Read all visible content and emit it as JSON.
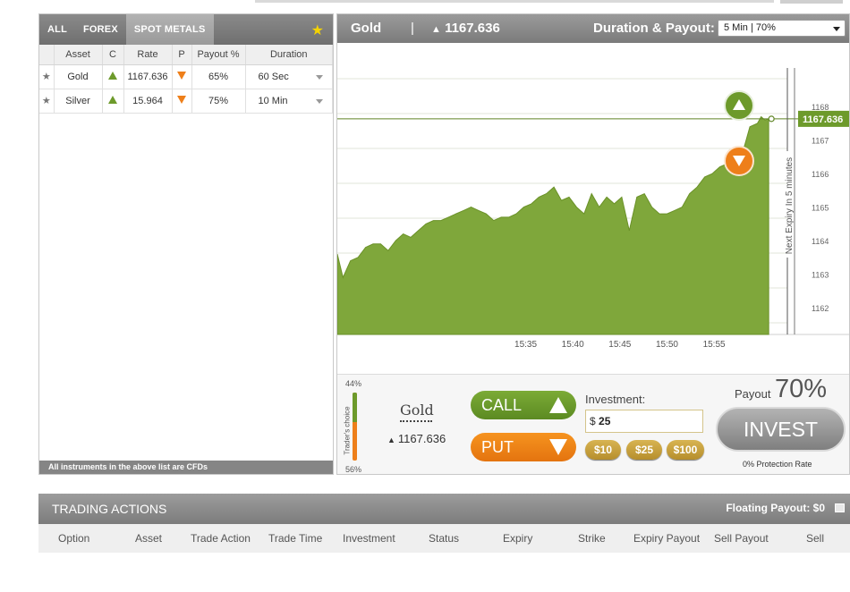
{
  "tabs": [
    {
      "label": "ALL"
    },
    {
      "label": "FOREX"
    },
    {
      "label": "SPOT METALS",
      "active": true
    }
  ],
  "asset_table": {
    "headers": [
      "Asset",
      "C",
      "Rate",
      "P",
      "Payout %",
      "Duration"
    ],
    "rows": [
      {
        "asset": "Gold",
        "rate": "1167.636",
        "payout": "65%",
        "duration": "60 Sec"
      },
      {
        "asset": "Silver",
        "rate": "15.964",
        "payout": "75%",
        "duration": "10 Min"
      }
    ]
  },
  "cfd_note": "All instruments in the above list are CFDs",
  "chart_header": {
    "asset": "Gold",
    "separator": "|",
    "rate": "1167.636",
    "duration_payout_label": "Duration & Payout:",
    "duration_payout_value": "5 Min | 70%"
  },
  "chart_data": {
    "type": "area",
    "x_ticks": [
      "15:35",
      "15:40",
      "15:45",
      "15:50",
      "15:55"
    ],
    "y_ticks": [
      "1168",
      "1167",
      "1166",
      "1165",
      "1164",
      "1163",
      "1162"
    ],
    "ylim": [
      1161.2,
      1168.3
    ],
    "current_price_label": "1167.636",
    "expiry_label": "Next Expiry In 5 minutes",
    "series": [
      {
        "color": "#7fa73b",
        "points": [
          [
            15.0,
            1163.6
          ],
          [
            15.6,
            1162.9
          ],
          [
            16.4,
            1163.4
          ],
          [
            17.2,
            1163.5
          ],
          [
            18.0,
            1163.8
          ],
          [
            18.8,
            1163.9
          ],
          [
            19.6,
            1163.9
          ],
          [
            20.4,
            1163.7
          ],
          [
            21.2,
            1164.0
          ],
          [
            22.0,
            1164.2
          ],
          [
            22.8,
            1164.1
          ],
          [
            23.6,
            1164.3
          ],
          [
            24.4,
            1164.5
          ],
          [
            25.2,
            1164.6
          ],
          [
            26.0,
            1164.6
          ],
          [
            26.8,
            1164.7
          ],
          [
            27.6,
            1164.8
          ],
          [
            28.4,
            1164.9
          ],
          [
            29.2,
            1165.0
          ],
          [
            30.0,
            1164.9
          ],
          [
            30.8,
            1164.8
          ],
          [
            31.6,
            1164.6
          ],
          [
            32.4,
            1164.7
          ],
          [
            33.2,
            1164.7
          ],
          [
            34.0,
            1164.8
          ],
          [
            34.8,
            1165.0
          ],
          [
            35.6,
            1165.1
          ],
          [
            36.4,
            1165.3
          ],
          [
            37.2,
            1165.4
          ],
          [
            38.0,
            1165.6
          ],
          [
            38.8,
            1165.2
          ],
          [
            39.6,
            1165.3
          ],
          [
            40.4,
            1165.0
          ],
          [
            41.2,
            1164.8
          ],
          [
            42.0,
            1165.4
          ],
          [
            42.8,
            1165.0
          ],
          [
            43.6,
            1165.3
          ],
          [
            44.4,
            1165.1
          ],
          [
            45.2,
            1165.3
          ],
          [
            46.0,
            1164.3
          ],
          [
            46.8,
            1165.3
          ],
          [
            47.6,
            1165.4
          ],
          [
            48.4,
            1165.0
          ],
          [
            49.2,
            1164.8
          ],
          [
            50.0,
            1164.8
          ],
          [
            50.8,
            1164.9
          ],
          [
            51.6,
            1165.0
          ],
          [
            52.4,
            1165.4
          ],
          [
            53.2,
            1165.6
          ],
          [
            54.0,
            1165.9
          ],
          [
            54.8,
            1166.0
          ],
          [
            55.6,
            1166.2
          ],
          [
            56.4,
            1166.3
          ],
          [
            57.2,
            1166.4
          ],
          [
            58.0,
            1166.6
          ],
          [
            58.8,
            1167.4
          ],
          [
            59.6,
            1167.5
          ],
          [
            60.0,
            1167.7
          ],
          [
            60.4,
            1167.6
          ],
          [
            60.8,
            1167.636
          ]
        ]
      }
    ]
  },
  "controls": {
    "traders_choice_top": "44%",
    "traders_choice_bottom": "56%",
    "traders_choice_label": "Trader's choice",
    "traders_choice_call_fraction": 0.44,
    "asset": "Gold",
    "rate": "1167.636",
    "call_label": "CALL",
    "put_label": "PUT",
    "investment_label": "Investment:",
    "investment_currency": "$",
    "investment_value": "25",
    "quick_amounts": [
      "$10",
      "$25",
      "$100"
    ],
    "payout_label": "Payout",
    "payout_value": "70%",
    "invest_label": "INVEST",
    "protection_rate": "0% Protection Rate"
  },
  "trading_actions": {
    "title": "TRADING ACTIONS",
    "floating_payout": "Floating Payout:  $0",
    "columns": [
      "Option",
      "Asset",
      "Trade Action",
      "Trade Time",
      "Investment",
      "Status",
      "Expiry",
      "Strike",
      "Expiry Payout",
      "Sell Payout",
      "Sell"
    ]
  },
  "colors": {
    "call_green": "#6d9a2b",
    "put_orange": "#ee7f1a",
    "chart_fill": "#7fa73b",
    "gold_button": "#c9a23f"
  }
}
